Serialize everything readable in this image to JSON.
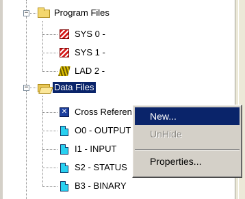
{
  "tree": {
    "program_files": {
      "label": "Program Files",
      "expander": "−"
    },
    "programs": [
      {
        "label": "SYS 0 -",
        "icon": "ladder-system-icon"
      },
      {
        "label": "SYS 1 -",
        "icon": "ladder-system-icon"
      },
      {
        "label": "LAD 2 -",
        "icon": "ladder-icon"
      }
    ],
    "data_files": {
      "label": "Data Files",
      "expander": "−"
    },
    "data": [
      {
        "label": "Cross Reference",
        "icon": "cross-reference-icon"
      },
      {
        "label": "O0 - OUTPUT",
        "icon": "data-file-icon"
      },
      {
        "label": "I1 - INPUT",
        "icon": "data-file-icon"
      },
      {
        "label": "S2 - STATUS",
        "icon": "data-file-icon"
      },
      {
        "label": "B3 - BINARY",
        "icon": "data-file-icon"
      }
    ]
  },
  "context_menu": {
    "items": [
      {
        "label": "New...",
        "state": "highlighted"
      },
      {
        "label": "UnHide",
        "state": "disabled"
      },
      {
        "label": "Properties...",
        "state": "normal"
      }
    ]
  },
  "colors": {
    "selection": "#0a246a",
    "menu_background": "#d4d0c8",
    "folder": "#f4d76e",
    "data_file": "#28d0f0",
    "system_ladder": "#d61a1a"
  }
}
